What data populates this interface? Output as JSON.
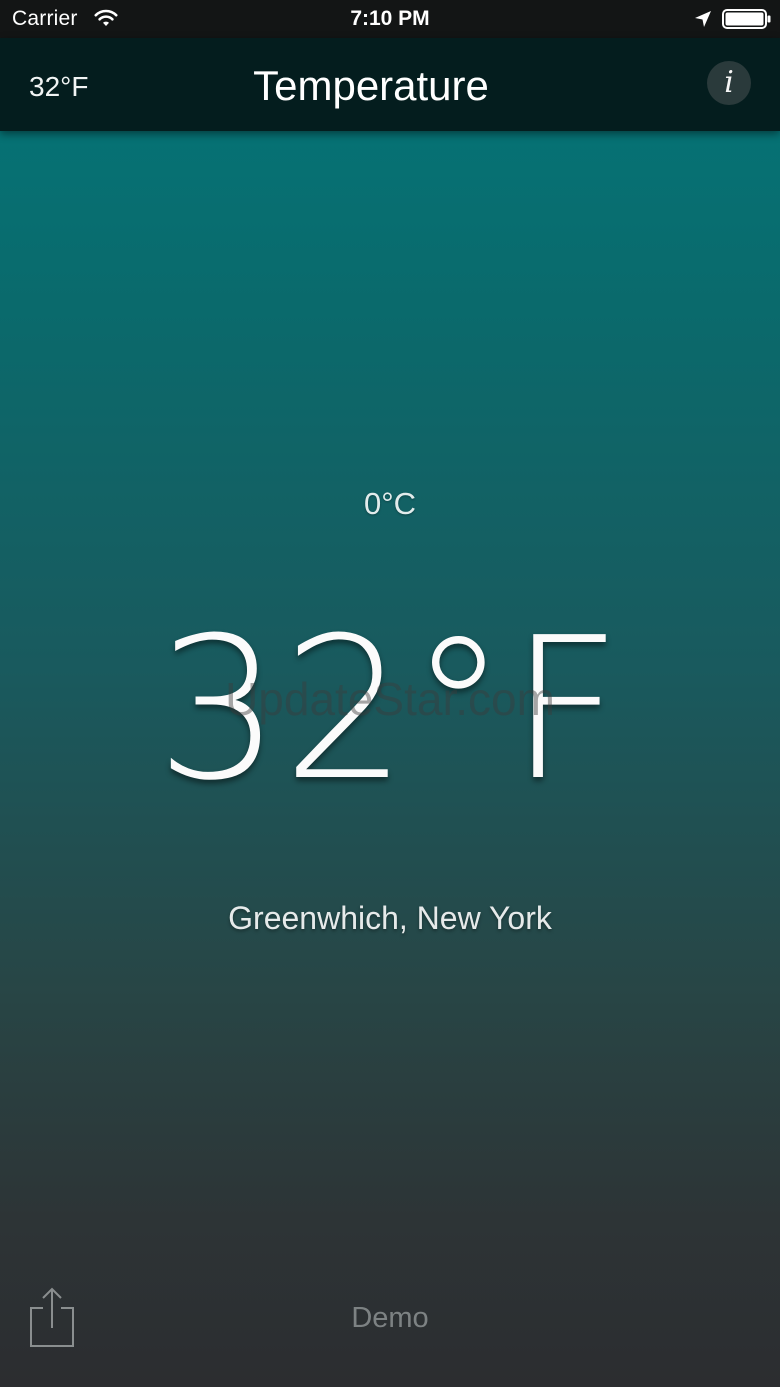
{
  "status_bar": {
    "carrier": "Carrier",
    "time": "7:10 PM",
    "icons": [
      "wifi-icon",
      "location-arrow-icon",
      "battery-icon"
    ]
  },
  "nav_bar": {
    "left_label": "32°F",
    "title": "Temperature",
    "info_button_label": "i"
  },
  "main": {
    "celsius": "0°C",
    "fahrenheit": "32°F",
    "location": "Greenwhich, New York",
    "watermark": "UpdateStar.com"
  },
  "bottom_bar": {
    "share_icon": "share-icon",
    "mode_label": "Demo"
  },
  "colors": {
    "gradient_top": "#03777a",
    "gradient_bottom": "#2c2d30",
    "nav_background": "#041d1e",
    "status_background": "#131515"
  }
}
